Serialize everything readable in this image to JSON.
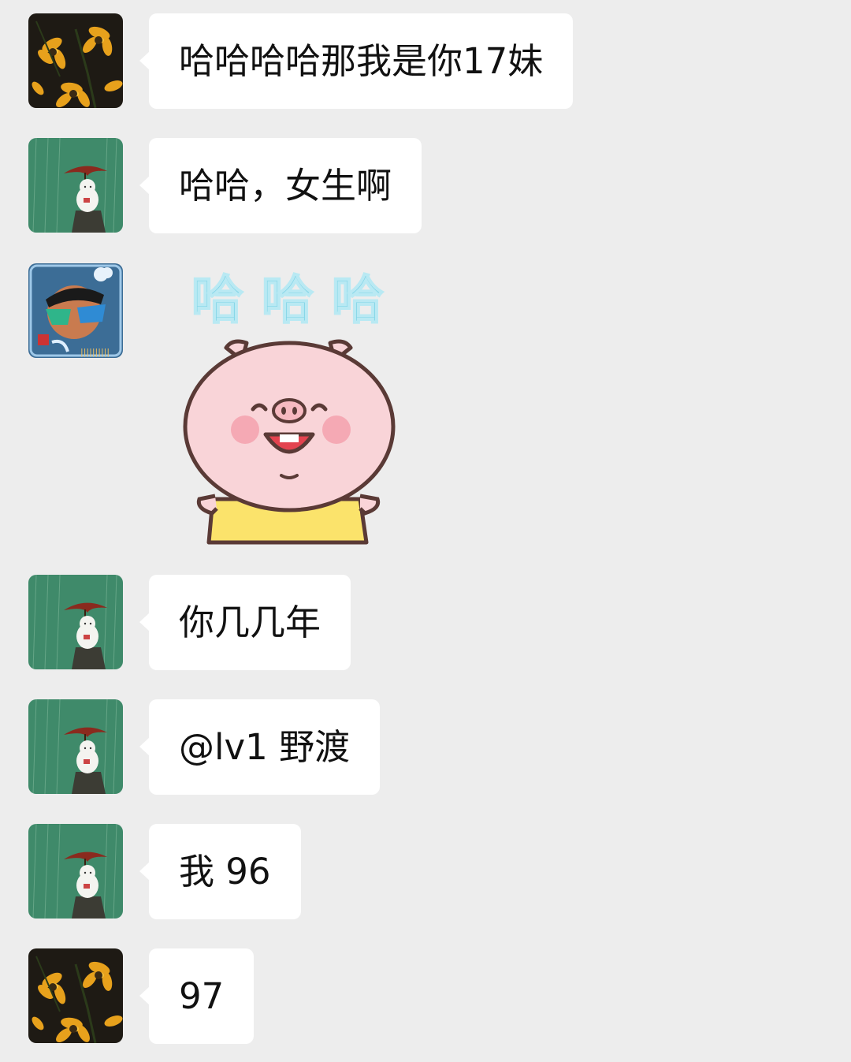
{
  "messages": [
    {
      "avatar": "sunflower-avatar",
      "text": "哈哈哈哈那我是你17妹"
    },
    {
      "avatar": "rain-pig-avatar",
      "text": "哈哈，女生啊"
    },
    {
      "avatar": "sunglasses-avatar",
      "sticker": {
        "caption": "哈 哈 哈",
        "icon": "laughing-pig-sticker"
      }
    },
    {
      "avatar": "rain-pig-avatar",
      "text": "你几几年"
    },
    {
      "avatar": "rain-pig-avatar",
      "text": "@lv1  野渡"
    },
    {
      "avatar": "rain-pig-avatar",
      "text": "我 96"
    },
    {
      "avatar": "sunflower-avatar",
      "text": "97"
    }
  ],
  "colors": {
    "background": "#ededed",
    "bubble": "#ffffff",
    "text": "#111111",
    "sticker_caption": "#7fd3e6",
    "pig_pink": "#f9d4d8",
    "pig_shirt": "#fbe36b"
  }
}
